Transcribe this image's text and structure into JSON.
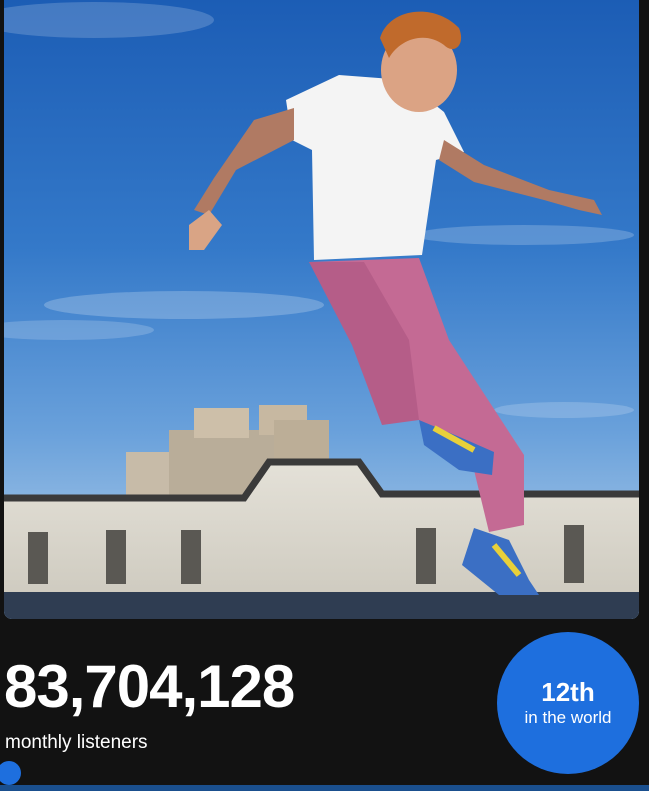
{
  "artist_card": {
    "photo_alt": "artist-photo"
  },
  "stats": {
    "monthly_listeners": "83,704,128",
    "monthly_listeners_label": "monthly listeners",
    "rank": "12th",
    "rank_label": "in the world"
  },
  "progress": {
    "position": 0.0
  },
  "colors": {
    "background": "#121212",
    "accent": "#1e6fde",
    "text": "#ffffff"
  }
}
